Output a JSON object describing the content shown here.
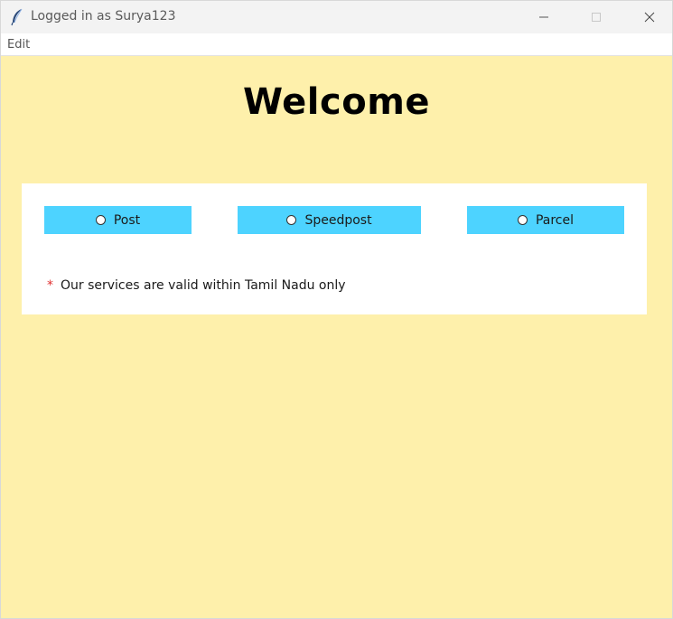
{
  "window": {
    "title": "Logged in as Surya123"
  },
  "menu": {
    "items": [
      "Edit"
    ]
  },
  "main": {
    "heading": "Welcome",
    "options": [
      {
        "label": "Post",
        "selected": false
      },
      {
        "label": "Speedpost",
        "selected": false
      },
      {
        "label": "Parcel",
        "selected": false
      }
    ],
    "note_marker": "*",
    "note_text": "Our services are valid within Tamil Nadu only"
  },
  "colors": {
    "background": "#fef0ab",
    "panel": "#ffffff",
    "option_button": "#4dd3ff",
    "asterisk": "#e03030"
  },
  "icons": {
    "app": "feather-icon",
    "minimize": "minimize-icon",
    "maximize": "maximize-icon",
    "close": "close-icon"
  }
}
